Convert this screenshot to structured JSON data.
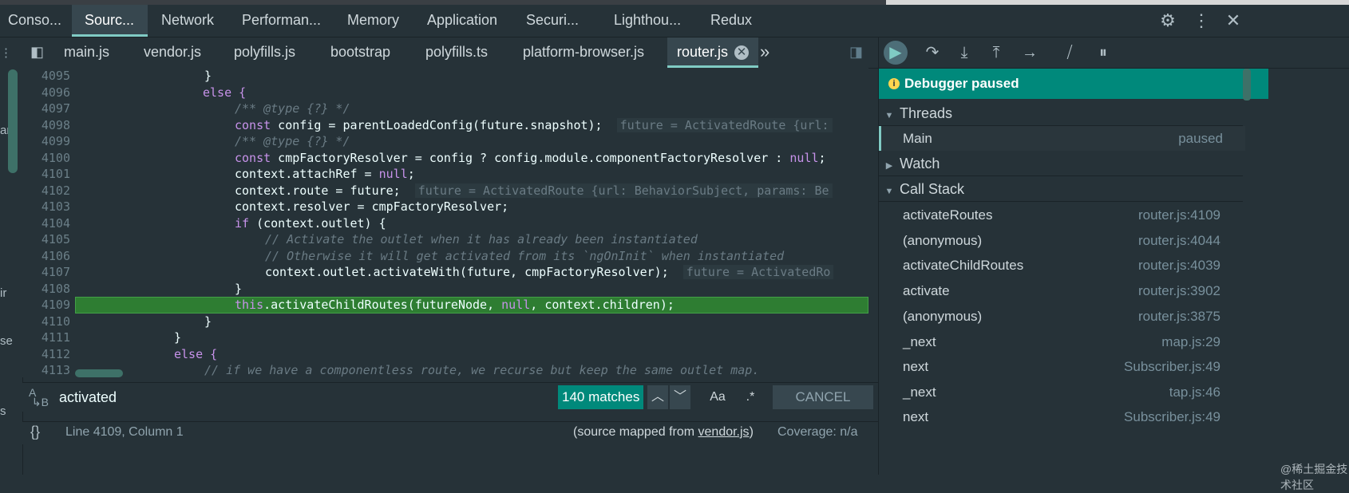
{
  "panel_tabs": [
    {
      "label": "Conso..."
    },
    {
      "label": "Sourc..."
    },
    {
      "label": "Network"
    },
    {
      "label": "Performan..."
    },
    {
      "label": "Memory"
    },
    {
      "label": "Application"
    },
    {
      "label": "Securi..."
    },
    {
      "label": "Lighthou..."
    },
    {
      "label": "Redux"
    }
  ],
  "file_tabs": [
    {
      "label": "main.js"
    },
    {
      "label": "vendor.js"
    },
    {
      "label": "polyfills.js"
    },
    {
      "label": "bootstrap"
    },
    {
      "label": "polyfills.ts"
    },
    {
      "label": "platform-browser.js"
    },
    {
      "label": "router.js"
    }
  ],
  "left_sliver": [
    "ar",
    "ir",
    "se",
    "s"
  ],
  "code_lines": [
    {
      "n": "4095",
      "text": "}"
    },
    {
      "n": "4096",
      "text": "else {"
    },
    {
      "n": "4097",
      "text": "/** @type {?} */"
    },
    {
      "n": "4098",
      "text": "const config = parentLoadedConfig(future.snapshot);",
      "hint": "future = ActivatedRoute {url:"
    },
    {
      "n": "4099",
      "text": "/** @type {?} */"
    },
    {
      "n": "4100",
      "text": "const cmpFactoryResolver = config ? config.module.componentFactoryResolver : null;"
    },
    {
      "n": "4101",
      "text": "context.attachRef = null;"
    },
    {
      "n": "4102",
      "text": "context.route = future;",
      "hint": "future = ActivatedRoute {url: BehaviorSubject, params: Be"
    },
    {
      "n": "4103",
      "text": "context.resolver = cmpFactoryResolver;"
    },
    {
      "n": "4104",
      "text": "if (context.outlet) {"
    },
    {
      "n": "4105",
      "text": "// Activate the outlet when it has already been instantiated"
    },
    {
      "n": "4106",
      "text": "// Otherwise it will get activated from its `ngOnInit` when instantiated"
    },
    {
      "n": "4107",
      "text": "context.outlet.activateWith(future, cmpFactoryResolver);",
      "hint": "future = ActivatedRo"
    },
    {
      "n": "4108",
      "text": "}"
    },
    {
      "n": "4109",
      "text": "this.activateChildRoutes(futureNode, null, context.children);"
    },
    {
      "n": "4110",
      "text": "}"
    },
    {
      "n": "4111",
      "text": "}"
    },
    {
      "n": "4112",
      "text": "else {"
    },
    {
      "n": "4113",
      "text": "// if we have a componentless route, we recurse but keep the same outlet map."
    }
  ],
  "search": {
    "value": "activated",
    "match_count": "140 matches",
    "case_label": "Aa",
    "regex_label": ".*",
    "cancel_label": "CANCEL"
  },
  "status": {
    "position": "Line 4109, Column 1",
    "source_prefix": "(source mapped from ",
    "source_link": "vendor.js",
    "source_suffix": ")",
    "coverage": "Coverage: n/a"
  },
  "debugger": {
    "banner": "Debugger paused",
    "threads_label": "Threads",
    "thread_name": "Main",
    "thread_state": "paused",
    "watch_label": "Watch",
    "callstack_label": "Call Stack",
    "frames": [
      {
        "fn": "activateRoutes",
        "loc": "router.js:4109"
      },
      {
        "fn": "(anonymous)",
        "loc": "router.js:4044"
      },
      {
        "fn": "activateChildRoutes",
        "loc": "router.js:4039"
      },
      {
        "fn": "activate",
        "loc": "router.js:3902"
      },
      {
        "fn": "(anonymous)",
        "loc": "router.js:3875"
      },
      {
        "fn": "_next",
        "loc": "map.js:29"
      },
      {
        "fn": "next",
        "loc": "Subscriber.js:49"
      },
      {
        "fn": "_next",
        "loc": "tap.js:46"
      },
      {
        "fn": "next",
        "loc": "Subscriber.js:49"
      }
    ]
  },
  "watermark": "@稀土掘金技术社区"
}
